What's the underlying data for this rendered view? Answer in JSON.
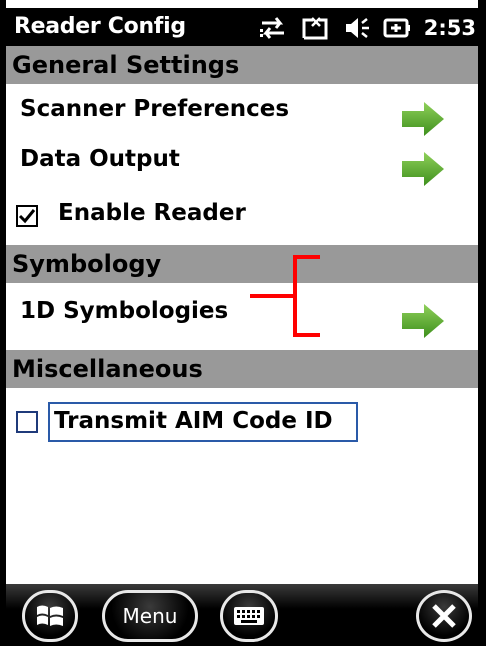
{
  "app_title": "Reader Config",
  "status": {
    "clock": "2:53",
    "icons": [
      "connectivity-icon",
      "signal-icon",
      "volume-icon",
      "battery-icon"
    ]
  },
  "sections": {
    "general": {
      "header": "General Settings",
      "scanner_preferences": "Scanner Preferences",
      "data_output": "Data Output",
      "enable_reader": {
        "label": "Enable Reader",
        "checked": true
      }
    },
    "symbology": {
      "header": "Symbology",
      "one_d": "1D Symbologies"
    },
    "misc": {
      "header": "Miscellaneous",
      "transmit_aim": {
        "label": "Transmit AIM Code ID",
        "checked": false
      }
    }
  },
  "taskbar": {
    "menu_label": "Menu"
  },
  "colors": {
    "section_header_bg": "#999999",
    "arrow_green": "#5fb431",
    "annotation_red": "#ff0000",
    "focus_blue": "#2a5aa8"
  }
}
